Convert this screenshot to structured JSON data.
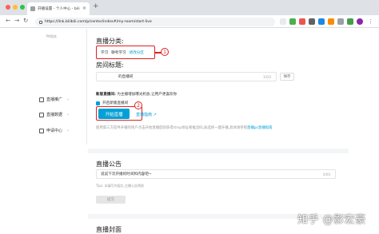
{
  "browser": {
    "tab_title": "开播设置 - 个人中心 - bilibili 个…",
    "tab_close": "×",
    "new_tab": "+",
    "url": "https://link.bilibili.com/p/center/index#/my-room/start-live",
    "back": "←",
    "forward": "→",
    "reload": "↻"
  },
  "sidebar": {
    "sub_label": "PK相关",
    "items": [
      {
        "label": "直播推广",
        "chevron": "›"
      },
      {
        "label": "直播数据",
        "chevron": "›"
      },
      {
        "label": "申请中心",
        "chevron": "›"
      }
    ]
  },
  "live": {
    "category_heading": "直播分类:",
    "categories": [
      "学习",
      "聊考学习"
    ],
    "category_change": "修改分区",
    "badge1": "1",
    "room_title_heading": "房间标题:",
    "room_title_value": "的直播间",
    "room_title_count": "1020",
    "save_label": "保存",
    "new_live_label": "新版直播间:",
    "new_live_desc": "为主播增加曝光机会,让用户更喜欢你",
    "checkbox_label": "开启新版直播间",
    "start_label": "开始直播",
    "badge2": "2",
    "guide_label": "直播指南",
    "guide_arrow": "↗",
    "hint_text": "使用第三方软件开播的用户点击开始直播后即获得rtmp地址和推流码,再选择一键开播,具体请参照",
    "hint_link": "直播pc直播指南"
  },
  "announcement": {
    "heading": "直播公告",
    "value": "说说下次开播的时间和内容吧~",
    "count": "0/60",
    "tip": "Tips: 本填写内容后,主播公告将前",
    "submit_label": "提交"
  },
  "cover": {
    "heading": "直播封面"
  },
  "watermark": "知乎 @影宏豪",
  "colors": {
    "accent": "#00a1d6",
    "annotation": "#e02020"
  }
}
